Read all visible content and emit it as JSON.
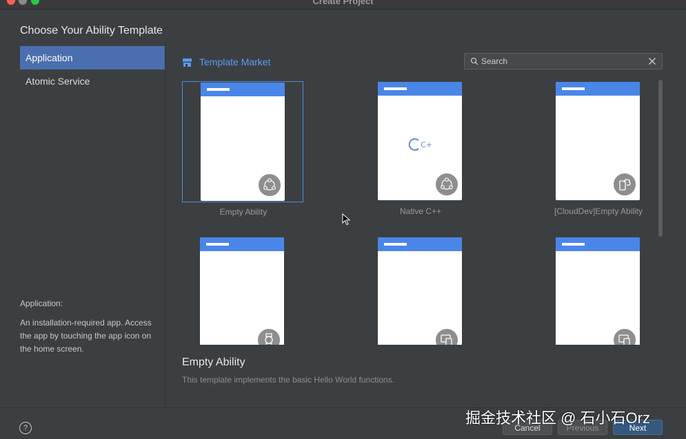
{
  "window": {
    "title": "Create Project"
  },
  "heading": "Choose Your Ability Template",
  "sidebar": {
    "items": [
      {
        "label": "Application",
        "active": true
      },
      {
        "label": "Atomic Service",
        "active": false
      }
    ],
    "description_title": "Application:",
    "description": "An installation-required app. Access the app by touching the app icon on the home screen."
  },
  "market": {
    "label": "Template Market",
    "icon": "store-icon"
  },
  "search": {
    "placeholder": "Search",
    "value": ""
  },
  "templates": [
    {
      "label": "Empty Ability",
      "icon": "ability-icon",
      "selected": true
    },
    {
      "label": "Native C++",
      "icon": "ability-icon",
      "logo": "C++",
      "selected": false
    },
    {
      "label": "[CloudDev]Empty Ability",
      "icon": "cloud-device-icon",
      "selected": false
    },
    {
      "label": "",
      "icon": "watch-icon",
      "selected": false
    },
    {
      "label": "",
      "icon": "devices-icon",
      "selected": false
    },
    {
      "label": "",
      "icon": "devices-icon",
      "selected": false
    }
  ],
  "selected_template": {
    "title": "Empty Ability",
    "description": "This template implements the basic Hello World functions."
  },
  "footer": {
    "help": "?",
    "cancel_label": "Cancel",
    "previous_label": "Previous",
    "next_label": "Next"
  },
  "watermark": "掘金技术社区 @ 石小石Orz",
  "colors": {
    "accent": "#4b6eaf",
    "link": "#589df6",
    "card_header": "#4a86e8",
    "background": "#3c3f41"
  }
}
